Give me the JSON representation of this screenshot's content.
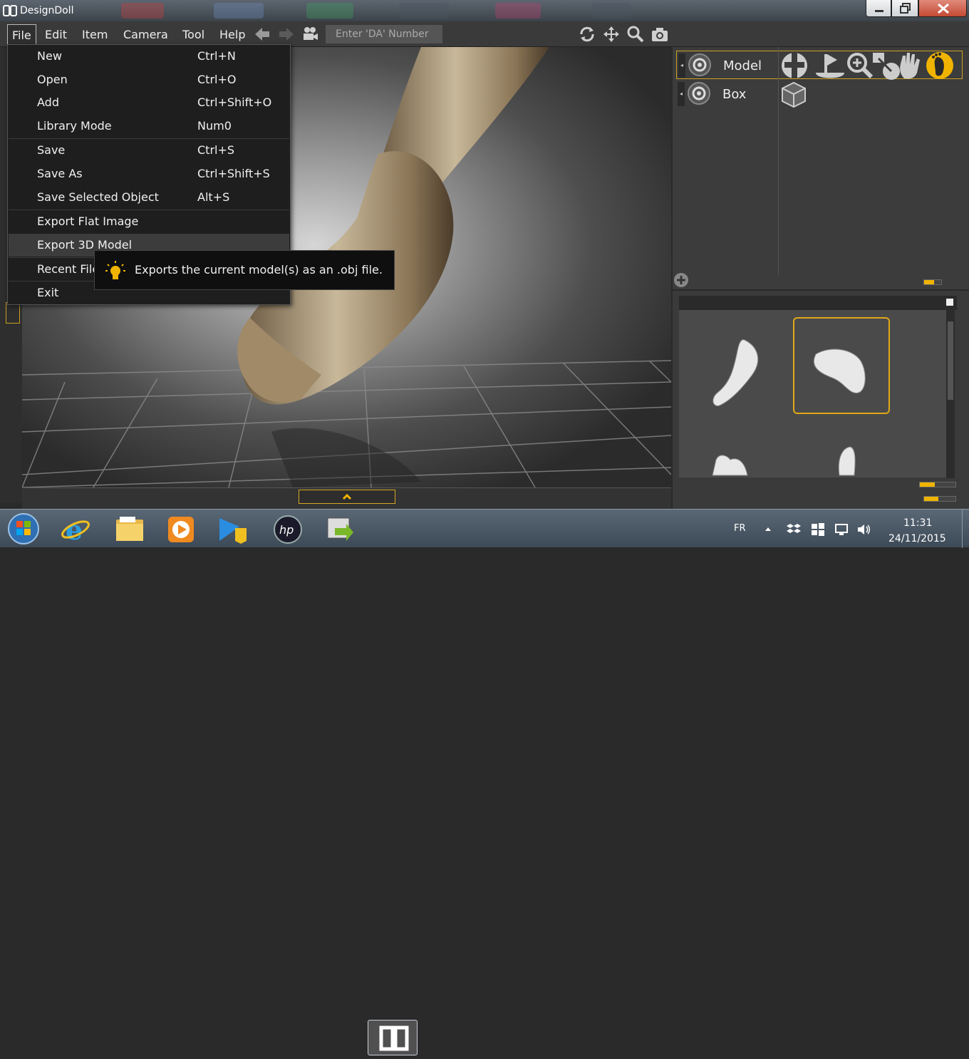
{
  "window": {
    "title": "DesignDoll"
  },
  "menubar": {
    "items": [
      "File",
      "Edit",
      "Item",
      "Camera",
      "Tool",
      "Help"
    ],
    "da_placeholder": "Enter 'DA' Number"
  },
  "file_menu": {
    "items": [
      {
        "label": "New",
        "shortcut": "Ctrl+N"
      },
      {
        "label": "Open",
        "shortcut": "Ctrl+O"
      },
      {
        "label": "Add",
        "shortcut": "Ctrl+Shift+O"
      },
      {
        "label": "Library Mode",
        "shortcut": "Num0"
      },
      {
        "label": "Save",
        "shortcut": "Ctrl+S"
      },
      {
        "label": "Save As",
        "shortcut": "Ctrl+Shift+S"
      },
      {
        "label": "Save Selected Object",
        "shortcut": "Alt+S"
      },
      {
        "label": "Export Flat Image",
        "shortcut": ""
      },
      {
        "label": "Export 3D Model",
        "shortcut": ""
      },
      {
        "label": "Recent Files",
        "shortcut": ""
      },
      {
        "label": "Exit",
        "shortcut": ""
      }
    ],
    "highlighted": "Export 3D Model"
  },
  "tooltip": {
    "text": "Exports the current model(s) as an .obj file."
  },
  "scene_panel": {
    "rows": [
      {
        "label": "Model",
        "selected": true
      },
      {
        "label": "Box",
        "selected": false
      }
    ]
  },
  "taskbar": {
    "language": "FR",
    "time": "11:31",
    "date": "24/11/2015"
  },
  "colors": {
    "accent": "#f0b400",
    "menu_bg": "#1e1e1e",
    "highlight": "#3c3c3c"
  }
}
